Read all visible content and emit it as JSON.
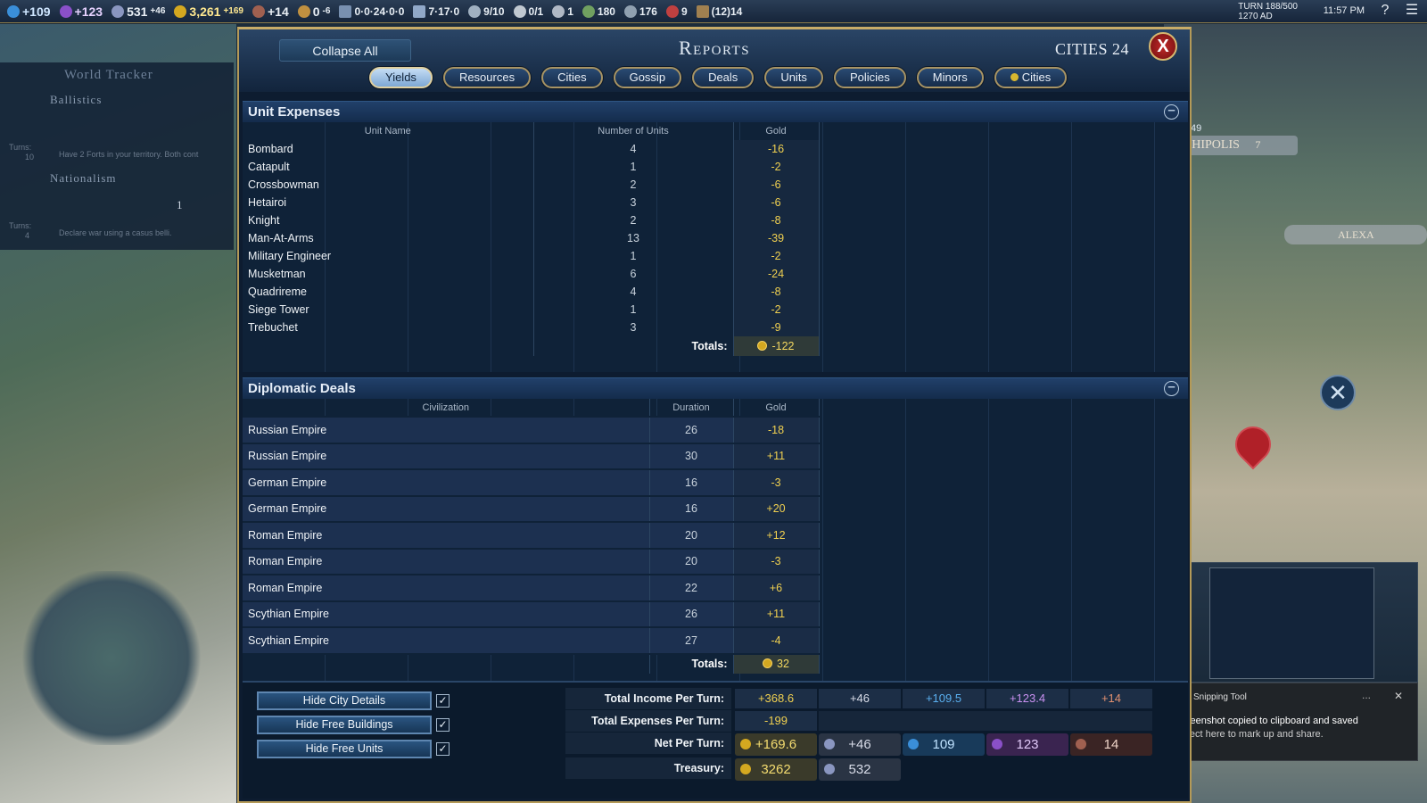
{
  "topbar": {
    "science": "+109",
    "faith": "+123",
    "culture": "531",
    "culture_delta": "+46",
    "gold": "3,261",
    "gold_delta": "+169",
    "tourism": "+14",
    "happiness": "0",
    "happiness_delta": "-6",
    "trade": "0·0·24·0·0",
    "routes": "7·17·0",
    "great": "9/10",
    "era": "0/1",
    "spies": "1",
    "res1": "180",
    "res2": "176",
    "res3": "9",
    "res4": "(12)14",
    "turn": "TURN 188/500",
    "year": "1270 AD",
    "clock": "11:57 PM",
    "help": "?",
    "menu": "☰"
  },
  "tracker": {
    "title": "World Tracker",
    "item1": "Ballistics",
    "item1_turns_label": "Turns:",
    "item1_turns": "10",
    "item1_note": "Have 2 Forts in your territory. Both cont",
    "item2": "Nationalism",
    "item2_turns_label": "Turns:",
    "item2_turns": "4",
    "item2_count": "1",
    "item2_note": "Declare war using a casus belli."
  },
  "map": {
    "city1": "MPHIPOLIS",
    "city1_pop": "7",
    "city1_badge": "49",
    "city2": "ALEXA"
  },
  "panel": {
    "collapse_label": "Collapse All",
    "title": "Reports",
    "cities_count": "CITIES 24",
    "close_label": "X",
    "tabs": [
      "Yields",
      "Resources",
      "Cities",
      "Gossip",
      "Deals",
      "Units",
      "Policies",
      "Minors",
      "Cities"
    ]
  },
  "unit_expenses": {
    "title": "Unit Expenses",
    "headers": [
      "Unit Name",
      "Number of Units",
      "Gold"
    ],
    "rows": [
      [
        "Bombard",
        "4",
        "-16"
      ],
      [
        "Catapult",
        "1",
        "-2"
      ],
      [
        "Crossbowman",
        "2",
        "-6"
      ],
      [
        "Hetairoi",
        "3",
        "-6"
      ],
      [
        "Knight",
        "2",
        "-8"
      ],
      [
        "Man-At-Arms",
        "13",
        "-39"
      ],
      [
        "Military Engineer",
        "1",
        "-2"
      ],
      [
        "Musketman",
        "6",
        "-24"
      ],
      [
        "Quadrireme",
        "4",
        "-8"
      ],
      [
        "Siege Tower",
        "1",
        "-2"
      ],
      [
        "Trebuchet",
        "3",
        "-9"
      ]
    ],
    "totals_label": "Totals:",
    "totals_value": "-122"
  },
  "diplomatic_deals": {
    "title": "Diplomatic Deals",
    "headers": [
      "Civilization",
      "Duration",
      "Gold"
    ],
    "rows": [
      [
        "Russian Empire",
        "26",
        "-18"
      ],
      [
        "Russian Empire",
        "30",
        "+11"
      ],
      [
        "German Empire",
        "16",
        "-3"
      ],
      [
        "German Empire",
        "16",
        "+20"
      ],
      [
        "Roman Empire",
        "20",
        "+12"
      ],
      [
        "Roman Empire",
        "20",
        "-3"
      ],
      [
        "Roman Empire",
        "22",
        "+6"
      ],
      [
        "Scythian Empire",
        "26",
        "+11"
      ],
      [
        "Scythian Empire",
        "27",
        "-4"
      ]
    ],
    "totals_label": "Totals:",
    "totals_value": "32"
  },
  "footer": {
    "hide_city_details": "Hide City Details",
    "hide_free_buildings": "Hide Free Buildings",
    "hide_free_units": "Hide Free Units",
    "check": "✓",
    "income_label": "Total Income Per Turn:",
    "income": [
      "+368.6",
      "+46",
      "+109.5",
      "+123.4",
      "+14"
    ],
    "expenses_label": "Total Expenses Per Turn:",
    "expenses": "-199",
    "net_label": "Net Per Turn:",
    "net": [
      "+169.6",
      "+46",
      "109",
      "123",
      "14"
    ],
    "treasury_label": "Treasury:",
    "treasury": [
      "3262",
      "532"
    ]
  },
  "snip": {
    "app": "Snipping Tool",
    "dots": "...",
    "close": "✕",
    "line1": "Screenshot copied to clipboard and saved",
    "line2": "Select here to mark up and share."
  },
  "colors": {
    "gold": "#f0d050",
    "science": "#5ab0f0",
    "faith": "#c890f0",
    "culture": "#c0c8e0",
    "tourism": "#e09070",
    "panel_border": "#b49a58"
  }
}
